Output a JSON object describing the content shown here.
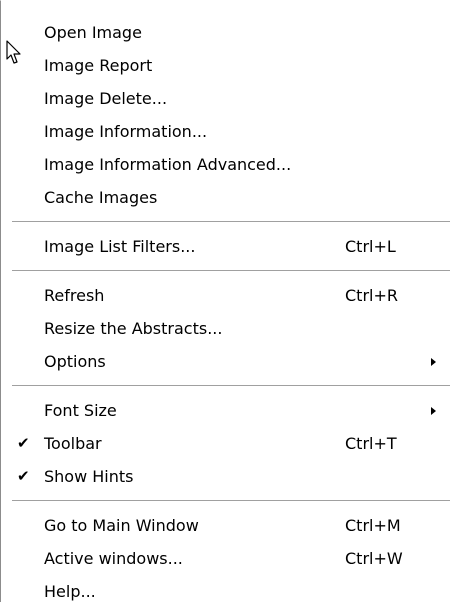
{
  "menu": {
    "open_image": {
      "label": "Open Image"
    },
    "image_report": {
      "label": "Image Report"
    },
    "image_delete": {
      "label": "Image Delete..."
    },
    "image_information": {
      "label": "Image Information..."
    },
    "image_information_advanced": {
      "label": "Image Information Advanced..."
    },
    "cache_images": {
      "label": "Cache Images"
    },
    "image_list_filters": {
      "label": "Image List Filters...",
      "shortcut": "Ctrl+L"
    },
    "refresh": {
      "label": "Refresh",
      "shortcut": "Ctrl+R"
    },
    "resize_abstracts": {
      "label": "Resize the Abstracts..."
    },
    "options": {
      "label": "Options"
    },
    "font_size": {
      "label": "Font Size"
    },
    "toolbar": {
      "label": "Toolbar",
      "shortcut": "Ctrl+T",
      "check": "✔"
    },
    "show_hints": {
      "label": "Show Hints",
      "check": "✔"
    },
    "go_to_main_window": {
      "label": "Go to Main Window",
      "shortcut": "Ctrl+M"
    },
    "active_windows": {
      "label": "Active windows...",
      "shortcut": "Ctrl+W"
    },
    "help": {
      "label": "Help..."
    }
  },
  "icons": {
    "cursor": "mouse-pointer-icon",
    "submenu_arrow": "triangle-right-icon",
    "check": "checkmark-icon"
  },
  "colors": {
    "background": "#ffffff",
    "text": "#000000",
    "separator": "#a0a0a0",
    "border": "#8c8c8c"
  }
}
